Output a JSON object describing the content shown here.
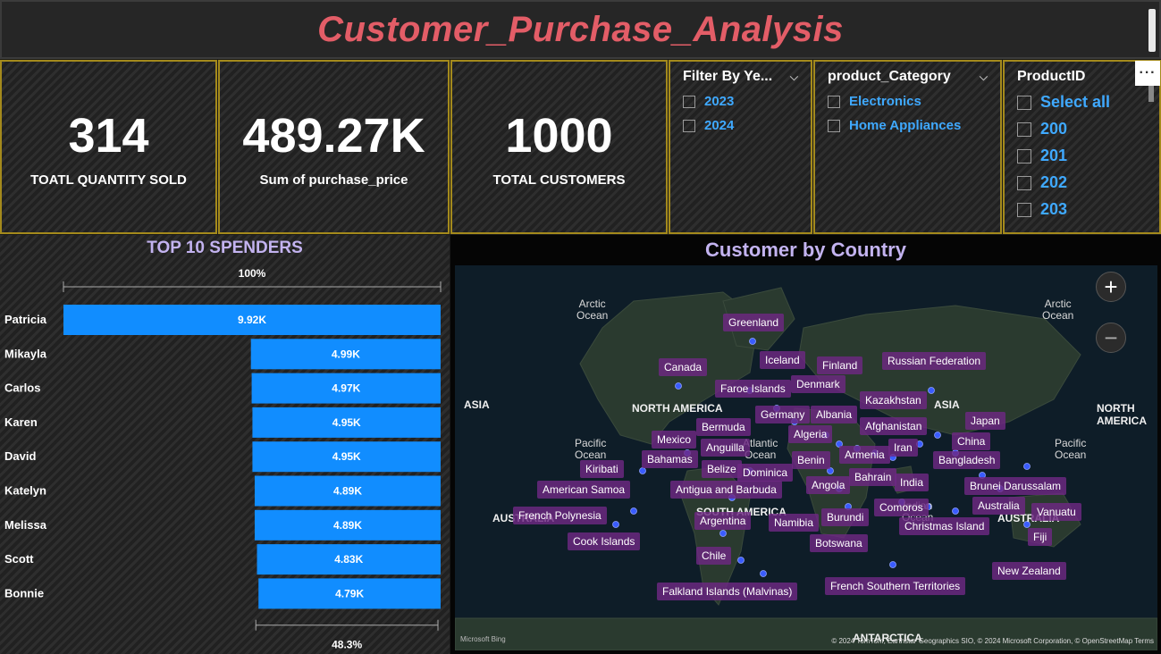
{
  "title": "Customer_Purchase_Analysis",
  "kpis": [
    {
      "value": "314",
      "label": "TOATL QUANTITY SOLD"
    },
    {
      "value": "489.27K",
      "label": "Sum of purchase_price"
    },
    {
      "value": "1000",
      "label": "TOTAL CUSTOMERS"
    }
  ],
  "slicers": {
    "year": {
      "title": "Filter By Ye...",
      "options": [
        "2023",
        "2024"
      ]
    },
    "category": {
      "title": "product_Category",
      "options": [
        "Electronics",
        "Home Appliances"
      ]
    },
    "product": {
      "title": "ProductID",
      "options": [
        "Select all",
        "200",
        "201",
        "202",
        "203"
      ]
    }
  },
  "more_options": "···",
  "spenders": {
    "title": "TOP 10 SPENDERS",
    "top_bound_label": "100%",
    "bottom_bound_label": "48.3%"
  },
  "chart_data": {
    "type": "bar",
    "orientation": "horizontal",
    "title": "TOP 10 SPENDERS",
    "categories": [
      "Patricia",
      "Mikayla",
      "Carlos",
      "Karen",
      "David",
      "Katelyn",
      "Melissa",
      "Scott",
      "Bonnie"
    ],
    "values": [
      9920,
      4990,
      4970,
      4950,
      4950,
      4890,
      4890,
      4830,
      4790
    ],
    "data_labels": [
      "9.92K",
      "4.99K",
      "4.97K",
      "4.95K",
      "4.95K",
      "4.89K",
      "4.89K",
      "4.83K",
      "4.79K"
    ],
    "bar_color": "#118dff",
    "max": 9920
  },
  "map": {
    "title": "Customer by Country",
    "oceans": [
      "Arctic\nOcean",
      "Arctic\nOcean",
      "Pacific\nOcean",
      "Atlantic\nOcean",
      "Pacific\nOcean",
      "Indian\nOcean"
    ],
    "regions": [
      "ASIA",
      "NORTH AMERICA",
      "ASIA",
      "NORTH AMERICA",
      "SOUTH AMERICA",
      "AUSTRALIA",
      "AUSTRALIA",
      "ANTARCTICA"
    ],
    "countries": [
      "Greenland",
      "Iceland",
      "Canada",
      "Finland",
      "Russian Federation",
      "Faroe Islands",
      "Denmark",
      "Kazakhstan",
      "Germany",
      "Albania",
      "Japan",
      "Afghanistan",
      "Bermuda",
      "Algeria",
      "Mexico",
      "Anguilla",
      "Iran",
      "China",
      "Bahamas",
      "Armenia",
      "Bangladesh",
      "Kiribati",
      "Belize",
      "Dominica",
      "Benin",
      "Bahrain",
      "India",
      "American Samoa",
      "Antigua and Barbuda",
      "Angola",
      "Brunei Darussalam",
      "French Polynesia",
      "Argentina",
      "Namibia",
      "Burundi",
      "Comoros",
      "Australia",
      "Vanuatu",
      "Christmas Island",
      "Cook Islands",
      "Botswana",
      "Fiji",
      "Chile",
      "New Zealand",
      "Falkland Islands (Malvinas)",
      "French Southern Territories"
    ],
    "zoom_in": "+",
    "zoom_out": "−",
    "bing": "Microsoft Bing",
    "attribution": "© 2024 TomTom, Earthstar Geographics SIO, © 2024 Microsoft Corporation, © OpenStreetMap  Terms"
  }
}
